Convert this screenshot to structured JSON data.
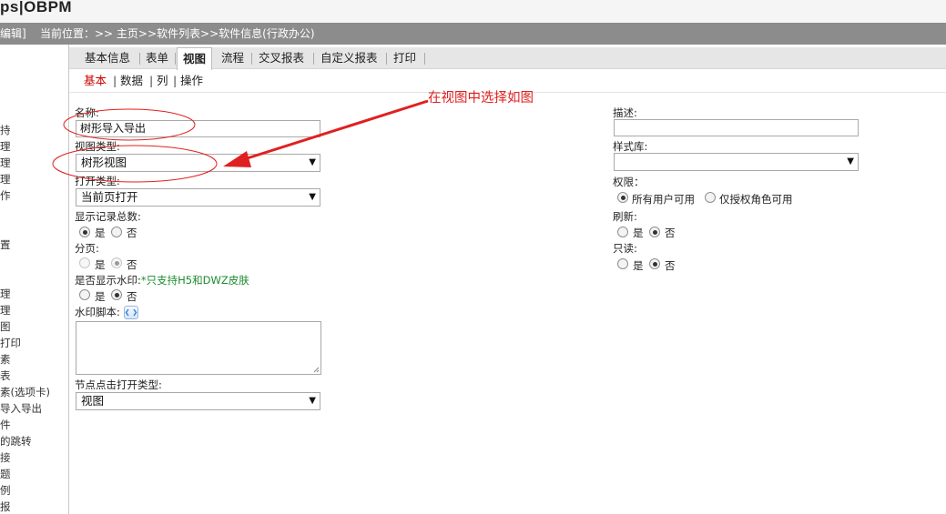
{
  "header": {
    "brand": "ps|OBPM"
  },
  "breadcrumb_bar": {
    "edit_label": "编辑]",
    "path": "当前位置：>> 主页>>软件列表>>软件信息(行政办公)"
  },
  "sidebar": {
    "items": [
      "持",
      "理",
      "理",
      "理",
      "作",
      "置",
      "理",
      "理",
      "图",
      "打印",
      "素",
      "表",
      "素(选项卡)",
      "导入导出",
      "件",
      "的跳转",
      "接",
      "题",
      "例",
      "报"
    ]
  },
  "main_tabs": [
    "基本信息",
    "表单",
    "视图",
    "流程",
    "交叉报表",
    "自定义报表",
    "打印"
  ],
  "active_main_tab": "视图",
  "sub_tabs": [
    "基本",
    "数据",
    "列",
    "操作"
  ],
  "active_sub_tab": "基本",
  "form": {
    "name": {
      "label": "名称:",
      "value": "树形导入导出"
    },
    "view_type": {
      "label": "视图类型:",
      "selected": "树形视图"
    },
    "open_type": {
      "label": "打开类型:",
      "selected": "当前页打开"
    },
    "show_total": {
      "label": "显示记录总数:",
      "yes": "是",
      "no": "否",
      "value": "是"
    },
    "paging": {
      "label": "分页:",
      "yes": "是",
      "no": "否",
      "value": "否",
      "disabled": true
    },
    "watermark": {
      "label": "是否显示水印:",
      "note": "*只支持H5和DWZ皮肤",
      "yes": "是",
      "no": "否",
      "value": "否"
    },
    "watermark_script": {
      "label": "水印脚本:",
      "value": ""
    },
    "node_click": {
      "label": "节点点击打开类型:",
      "selected": "视图"
    },
    "description": {
      "label": "描述:",
      "value": ""
    },
    "style_lib": {
      "label": "样式库:",
      "selected": ""
    },
    "permission": {
      "label": "权限：",
      "opt_all": "所有用户可用",
      "opt_role": "仅授权角色可用",
      "value": "所有用户可用"
    },
    "refresh": {
      "label": "刷新:",
      "yes": "是",
      "no": "否",
      "value": "否"
    },
    "readonly": {
      "label": "只读:",
      "yes": "是",
      "no": "否",
      "value": "否"
    }
  },
  "annotation": {
    "text": "在视图中选择如图",
    "color": "#e02020"
  },
  "icons": {
    "dropdown": "dropdown-arrow-icon",
    "script_editor": "script-editor-icon"
  }
}
